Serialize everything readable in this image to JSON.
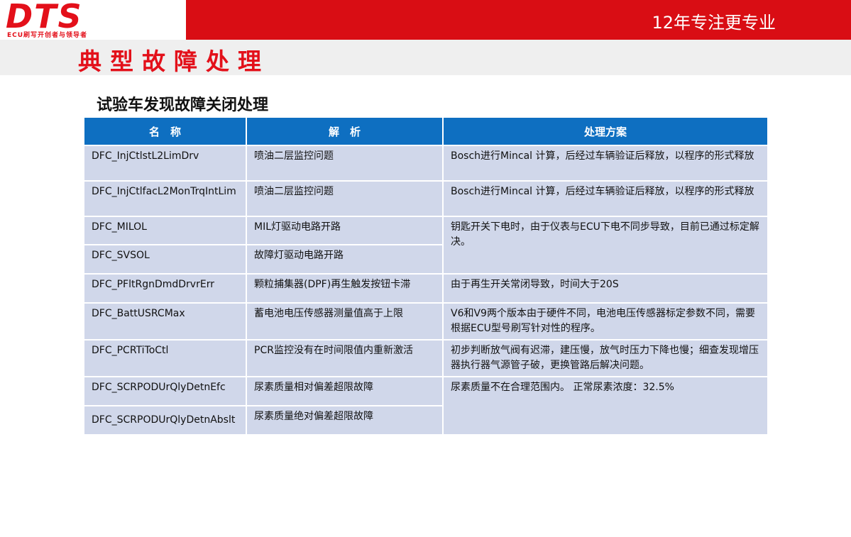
{
  "brand": {
    "logo": "DTS",
    "tagline": "ECU刷写开创者与领导者",
    "slogan": "12年专注更专业"
  },
  "page": {
    "title": "典型故障处理",
    "subtitle": "试验车发现故障关闭处理"
  },
  "colors": {
    "brand_red": "#d90d14",
    "header_blue": "#0e6fc1",
    "cell_bg": "#d0d7ea"
  },
  "table": {
    "headers": [
      "名　称",
      "解　析",
      "处理方案"
    ],
    "rows": [
      {
        "name": "DFC_InjCtlstL2LimDrv",
        "analysis": "喷油二层监控问题",
        "solution": "Bosch进行Mincal 计算，后经过车辆验证后释放，以程序的形式释放"
      },
      {
        "name": "DFC_InjCtlfacL2MonTrqIntLim",
        "analysis": "喷油二层监控问题",
        "solution": "Bosch进行Mincal 计算，后经过车辆验证后释放，以程序的形式释放"
      },
      {
        "name": "DFC_MILOL",
        "analysis": "MIL灯驱动电路开路",
        "solution": "钥匙开关下电时，由于仪表与ECU下电不同步导致，目前已通过标定解决。"
      },
      {
        "name": "DFC_SVSOL",
        "analysis": "故障灯驱动电路开路"
      },
      {
        "name": "DFC_PFltRgnDmdDrvrErr",
        "analysis": "颗粒捕集器(DPF)再生触发按钮卡滞",
        "solution": "由于再生开关常闭导致，时间大于20S"
      },
      {
        "name": "DFC_BattUSRCMax",
        "analysis": "蓄电池电压传感器测量值高于上限",
        "solution": "V6和V9两个版本由于硬件不同，电池电压传感器标定参数不同，需要根据ECU型号刷写针对性的程序。"
      },
      {
        "name": "DFC_PCRTiToCtl",
        "analysis": "PCR监控没有在时间限值内重新激活",
        "solution": "初步判断放气阀有迟滞，建压慢，放气时压力下降也慢；细查发现增压器执行器气源管子破，更换管路后解决问题。"
      },
      {
        "name": "DFC_SCRPODUrQlyDetnEfc",
        "analysis": "尿素质量相对偏差超限故障",
        "solution": "尿素质量不在合理范围内。  正常尿素浓度：32.5%"
      },
      {
        "name": "DFC_SCRPODUrQlyDetnAbslt",
        "analysis": "尿素质量绝对偏差超限故障"
      }
    ]
  }
}
